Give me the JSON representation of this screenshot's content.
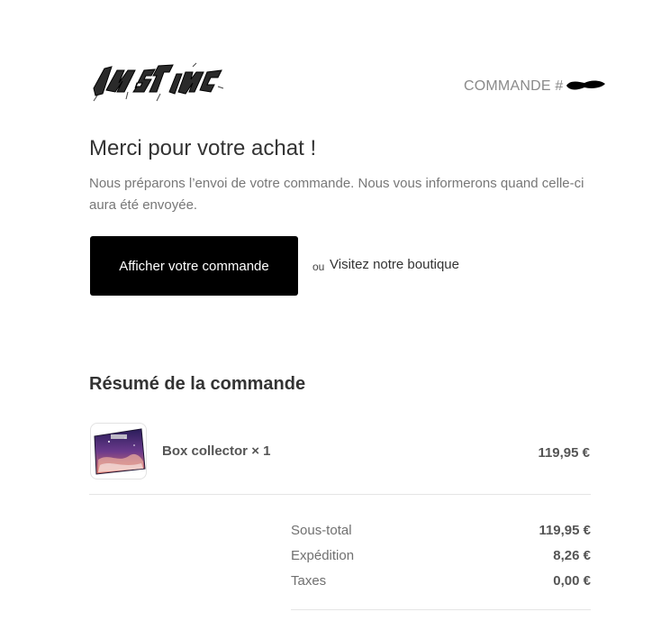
{
  "header": {
    "logo_text": "INSTINCT",
    "order_label": "COMMANDE #"
  },
  "main": {
    "title": "Merci pour votre achat !",
    "intro": "Nous préparons l’envoi de votre commande. Nous vous informerons quand celle-ci aura été envoyée.",
    "cta_label": "Afficher votre commande",
    "or_text": "ou",
    "shop_link": "Visitez notre boutique"
  },
  "summary": {
    "title": "Résumé de la commande",
    "items": [
      {
        "name": "Box collector × 1",
        "price": "119,95 €",
        "thumb_icon": "box-collector-image"
      }
    ],
    "totals": [
      {
        "label": "Sous-total",
        "value": "119,95 €"
      },
      {
        "label": "Expédition",
        "value": "8,26 €"
      },
      {
        "label": "Taxes",
        "value": "0,00 €"
      }
    ]
  },
  "colors": {
    "button_bg": "#000000",
    "button_text": "#ffffff",
    "muted_text": "#777777"
  }
}
